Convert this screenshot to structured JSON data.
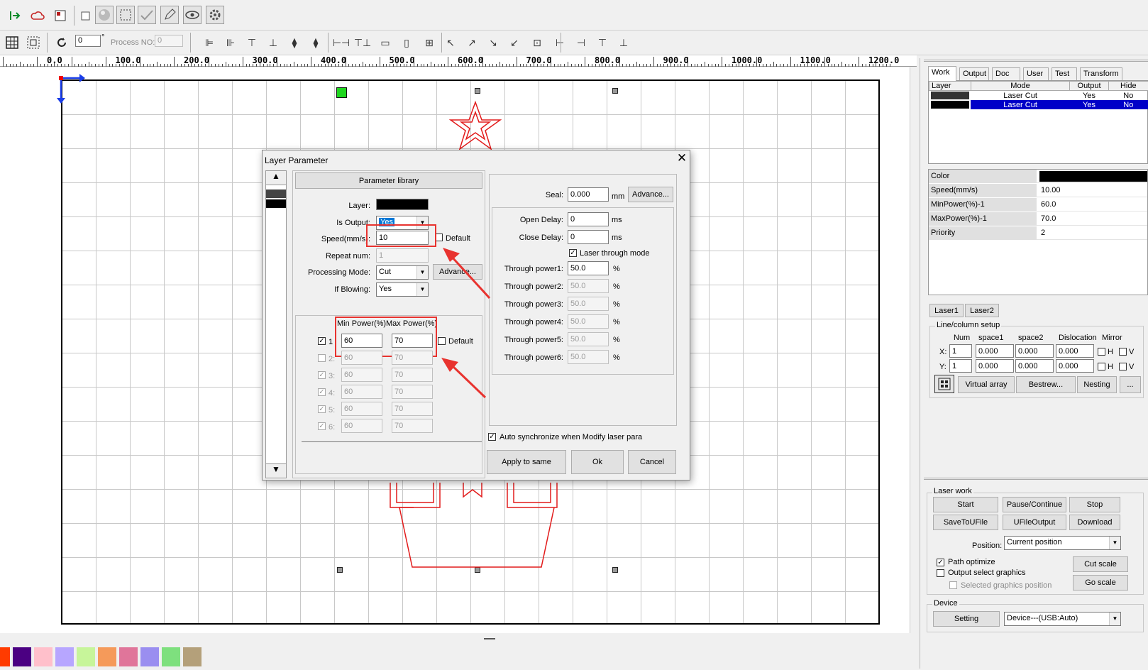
{
  "toolbar2": {
    "rotate_value": "0",
    "degree": "°",
    "process_no_label": "Process NO:",
    "process_no_value": "0"
  },
  "ruler": {
    "ticks": [
      "0.0",
      "100.0",
      "200.0",
      "300.0",
      "400.0",
      "500.0",
      "600.0",
      "700.0",
      "800.0",
      "900.0",
      "1000.0",
      "1100.0",
      "1200.0"
    ]
  },
  "panel": {
    "tabs": [
      "Work",
      "Output",
      "Doc",
      "User",
      "Test",
      "Transform"
    ],
    "layer_headers": [
      "Layer",
      "Mode",
      "Output",
      "Hide"
    ],
    "layers": [
      {
        "mode": "Laser Cut",
        "output": "Yes",
        "hide": "No"
      },
      {
        "mode": "Laser Cut",
        "output": "Yes",
        "hide": "No"
      }
    ],
    "props": [
      {
        "name": "Color",
        "value": ""
      },
      {
        "name": "Speed(mm/s)",
        "value": "10.00"
      },
      {
        "name": "MinPower(%)-1",
        "value": "60.0"
      },
      {
        "name": "MaxPower(%)-1",
        "value": "70.0"
      },
      {
        "name": "Priority",
        "value": "2"
      }
    ],
    "laser_tabs": [
      "Laser1",
      "Laser2"
    ],
    "linecol": {
      "title": "Line/column setup",
      "headers": [
        "Num",
        "space1",
        "space2",
        "Dislocation",
        "Mirror"
      ],
      "x_label": "X:",
      "y_label": "Y:",
      "x": [
        "1",
        "0.000",
        "0.000",
        "0.000"
      ],
      "y": [
        "1",
        "0.000",
        "0.000",
        "0.000"
      ],
      "h": "H",
      "v": "V"
    },
    "array_buttons": [
      "Virtual array",
      "Bestrew...",
      "Nesting",
      "..."
    ],
    "laserwork": {
      "title": "Laser work",
      "buttons": [
        "Start",
        "Pause/Continue",
        "Stop",
        "SaveToUFile",
        "UFileOutput",
        "Download"
      ],
      "position_label": "Position:",
      "position_value": "Current position",
      "path_optimize": "Path optimize",
      "output_select": "Output select graphics",
      "selected_pos": "Selected graphics position",
      "cut_scale": "Cut scale",
      "go_scale": "Go scale"
    },
    "device": {
      "title": "Device",
      "setting": "Setting",
      "value": "Device---(USB:Auto)"
    }
  },
  "dialog": {
    "title": "Layer Parameter",
    "param_library": "Parameter library",
    "layer_label": "Layer:",
    "is_output_label": "Is Output:",
    "is_output_value": "Yes",
    "speed_label": "Speed(mm/s):",
    "speed_value": "10",
    "default_label": "Default",
    "repeat_label": "Repeat num:",
    "repeat_value": "1",
    "mode_label": "Processing Mode:",
    "mode_value": "Cut",
    "advance": "Advance...",
    "blowing_label": "If Blowing:",
    "blowing_value": "Yes",
    "min_power_header": "Min Power(%)",
    "max_power_header": "Max Power(%)",
    "power_rows": [
      {
        "n": "1",
        "min": "60",
        "max": "70"
      },
      {
        "n": "2:",
        "min": "60",
        "max": "70"
      },
      {
        "n": "3:",
        "min": "60",
        "max": "70"
      },
      {
        "n": "4:",
        "min": "60",
        "max": "70"
      },
      {
        "n": "5:",
        "min": "60",
        "max": "70"
      },
      {
        "n": "6:",
        "min": "60",
        "max": "70"
      }
    ],
    "seal_label": "Seal:",
    "seal_value": "0.000",
    "mm": "mm",
    "seal_advance": "Advance...",
    "open_delay_label": "Open Delay:",
    "open_delay_value": "0",
    "close_delay_label": "Close Delay:",
    "close_delay_value": "0",
    "ms": "ms",
    "laser_through": "Laser through mode",
    "through": [
      {
        "label": "Through power1:",
        "value": "50.0"
      },
      {
        "label": "Through power2:",
        "value": "50.0"
      },
      {
        "label": "Through power3:",
        "value": "50.0"
      },
      {
        "label": "Through power4:",
        "value": "50.0"
      },
      {
        "label": "Through power5:",
        "value": "50.0"
      },
      {
        "label": "Through power6:",
        "value": "50.0"
      }
    ],
    "pct": "%",
    "auto_sync": "Auto synchronize when Modify laser para",
    "apply_same": "Apply to same",
    "ok": "Ok",
    "cancel": "Cancel"
  },
  "palette": [
    "#ff3b00",
    "#4b0082",
    "#ffc0cb",
    "#b7a6ff",
    "#c7f59a",
    "#f59a5a",
    "#e0759a",
    "#9a8ef0",
    "#7ee07e",
    "#b4a07a"
  ]
}
